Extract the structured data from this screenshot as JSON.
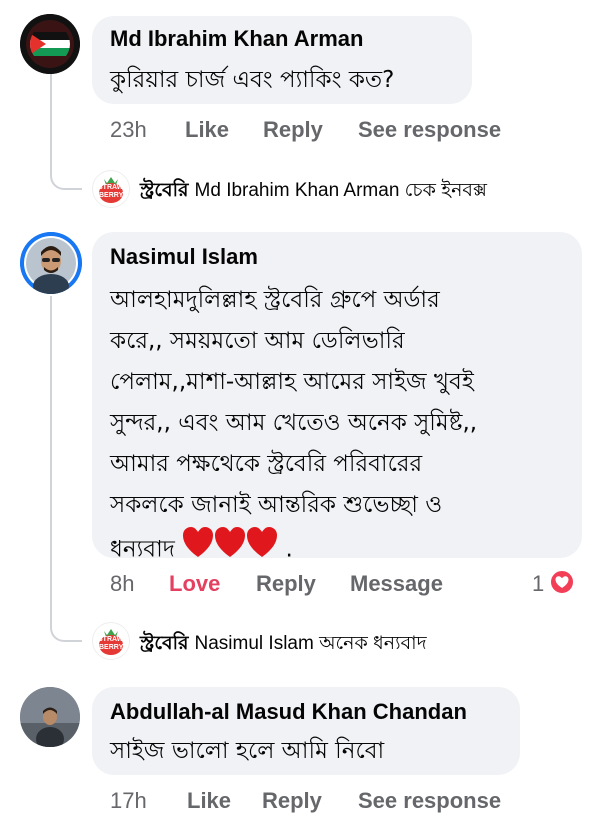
{
  "comments": [
    {
      "author": "Md Ibrahim Khan Arman",
      "text": "কুরিয়ার চার্জ এবং প্যাকিং কত?",
      "time": "23h",
      "actions": [
        "Like",
        "Reply",
        "See response"
      ],
      "reply": {
        "author": "স্ট্রবেরি",
        "text": "Md Ibrahim Khan Arman চেক ইনবক্স"
      }
    },
    {
      "author": "Nasimul Islam",
      "lines": [
        "আলহামদুলিল্লাহ স্ট্রবেরি গ্রুপে অর্ডার",
        "করে,, সময়মতো আম ডেলিভারি",
        "পেলাম,,মাশা-আল্লাহ আমের সাইজ খুবই",
        "সুন্দর,, এবং আম খেতেও অনেক সুমিষ্ট,,",
        "আমার পক্ষথেকে স্ট্রবেরি পরিবারের",
        "সকলকে জানাই আন্তরিক শুভেচ্ছা ও",
        "ধন্যবাদ"
      ],
      "trailing": ".",
      "time": "8h",
      "actions": [
        "Love",
        "Reply",
        "Message"
      ],
      "reaction_count": "1",
      "reply": {
        "author": "স্ট্রবেরি",
        "text": "Nasimul Islam অনেক ধন্যবাদ"
      }
    },
    {
      "author": "Abdullah-al Masud Khan Chandan",
      "text": "সাইজ ভালো হলে আমি নিবো",
      "time": "17h",
      "actions": [
        "Like",
        "Reply",
        "See response"
      ]
    }
  ],
  "page_logo_text": [
    "STRAW",
    "BERRY"
  ],
  "colors": {
    "love": "#e4405f",
    "meta_gray": "#65676b",
    "bubble": "#f0f2f5",
    "avatar_ring": "#1877f2"
  }
}
